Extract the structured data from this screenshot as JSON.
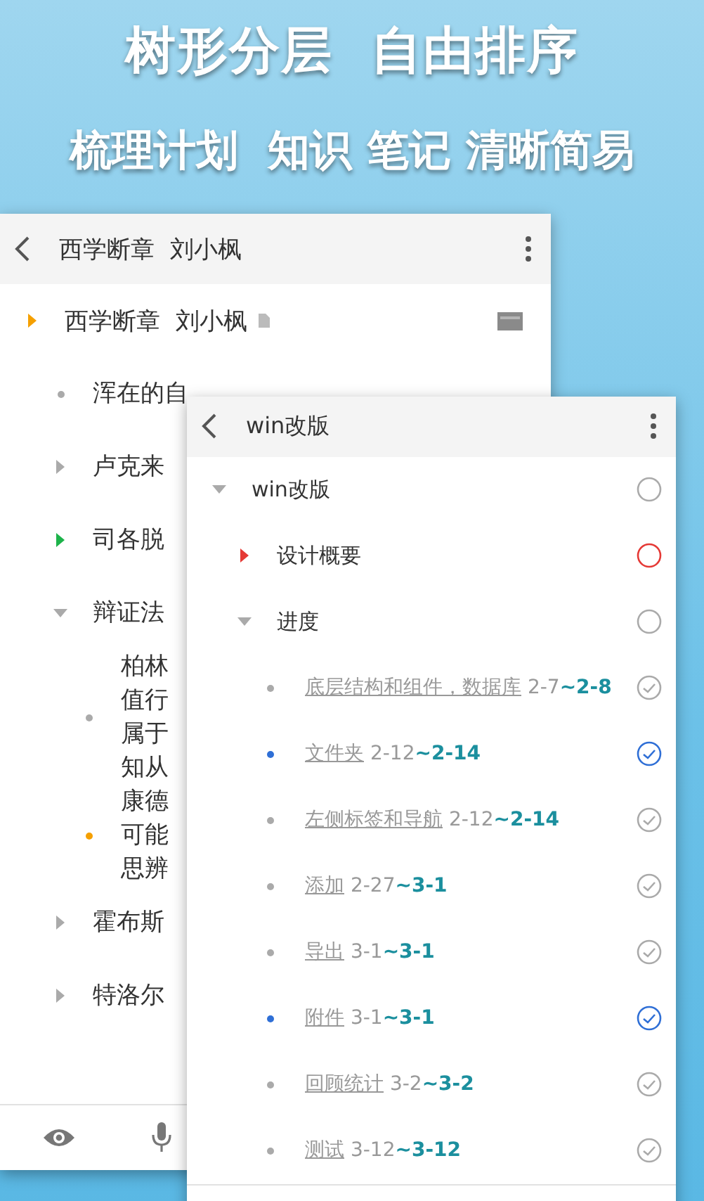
{
  "headline": [
    "树形分层  自由排序",
    "梳理计划  知识 笔记 清晰简易"
  ],
  "back_window": {
    "title": "西学断章  刘小枫",
    "tree": [
      {
        "kind": "arrow",
        "expanded": false,
        "color": "#f5a000",
        "label": "西学断章  刘小枫",
        "children": [
          {
            "kind": "dot",
            "color": "#aaaaaa",
            "lines": [
              "浑在的自"
            ]
          },
          {
            "kind": "arrow",
            "expanded": false,
            "color": "#aaaaaa",
            "lines": [
              "卢克来"
            ]
          },
          {
            "kind": "arrow",
            "expanded": false,
            "color": "#1db34a",
            "lines": [
              "司各脱"
            ]
          },
          {
            "kind": "arrow",
            "expanded": true,
            "color": "#aaaaaa",
            "lines": [
              "辩证法"
            ],
            "children": [
              {
                "kind": "dot",
                "color": "#aaaaaa",
                "lines": [
                  "柏林",
                  "值行",
                  "属于",
                  "知从"
                ]
              },
              {
                "kind": "dot",
                "color": "#f5a000",
                "lines": [
                  "康德",
                  "可能",
                  "思辨"
                ]
              }
            ]
          },
          {
            "kind": "arrow",
            "expanded": false,
            "color": "#aaaaaa",
            "lines": [
              "霍布斯"
            ]
          },
          {
            "kind": "arrow",
            "expanded": false,
            "color": "#aaaaaa",
            "lines": [
              "特洛尔"
            ]
          }
        ]
      }
    ]
  },
  "front_window": {
    "title": "win改版",
    "groups": [
      {
        "label": "win改版",
        "expanded": true,
        "color": "#aaaaaa",
        "depth_children": [
          {
            "label": "设计概要",
            "expanded": false,
            "color": "#e53935"
          },
          {
            "label": "进度",
            "expanded": true,
            "color": "#aaaaaa",
            "tasks": [
              {
                "title": "底层结构和组件，数据库",
                "start": "2-7",
                "end": "~2-8",
                "color": "#aaaaaa"
              },
              {
                "title": "文件夹",
                "start": "2-12",
                "end": "~2-14",
                "color": "#2f6fd6"
              },
              {
                "title": "左侧标签和导航",
                "start": "2-12",
                "end": "~2-14",
                "color": "#aaaaaa"
              },
              {
                "title": "添加",
                "start": "2-27",
                "end": "~3-1",
                "color": "#aaaaaa"
              },
              {
                "title": "导出",
                "start": "3-1",
                "end": "~3-1",
                "color": "#aaaaaa"
              },
              {
                "title": "附件",
                "start": "3-1",
                "end": "~3-1",
                "color": "#2f6fd6"
              },
              {
                "title": "回顾统计",
                "start": "3-2",
                "end": "~3-2",
                "color": "#aaaaaa"
              },
              {
                "title": "测试",
                "start": "3-12",
                "end": "~3-12",
                "color": "#aaaaaa"
              }
            ]
          }
        ]
      }
    ]
  }
}
